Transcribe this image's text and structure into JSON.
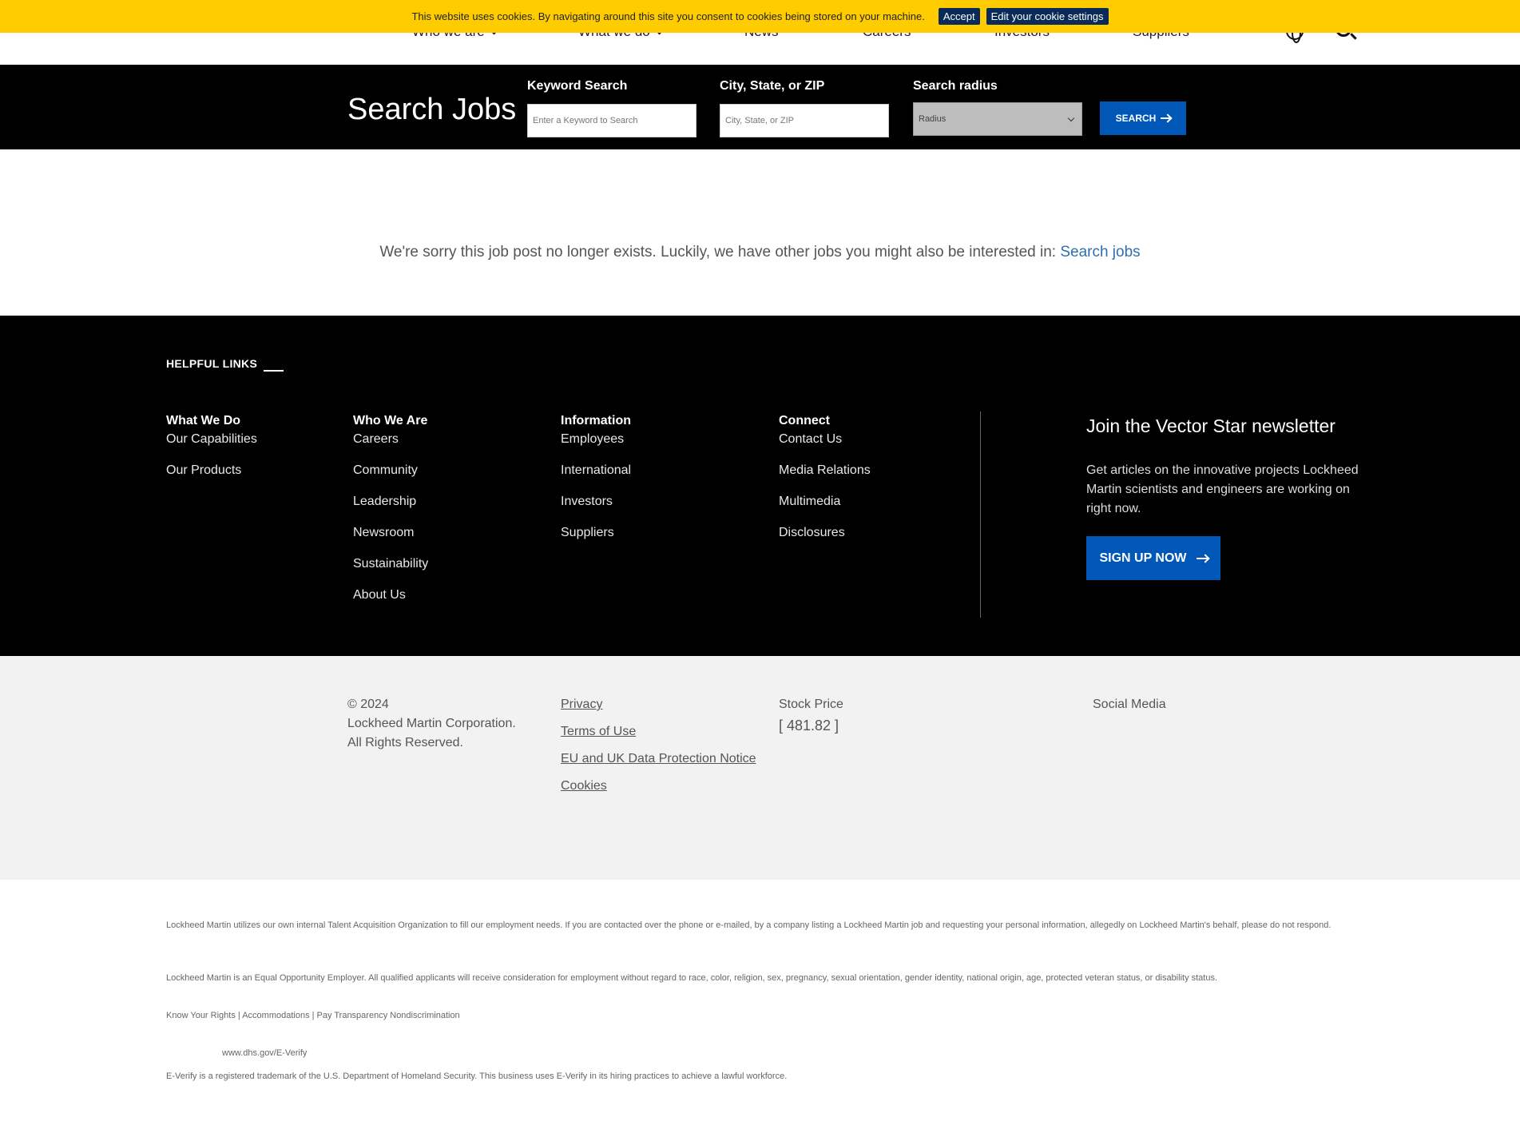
{
  "cookie": {
    "message": "This website uses cookies. By navigating around this site you consent to cookies being stored on your machine.",
    "accept_label": "Accept",
    "settings_label": "Edit your cookie settings"
  },
  "nav": {
    "items": [
      "Who we are",
      "What we do",
      "News",
      "Careers",
      "Investors",
      "Suppliers"
    ]
  },
  "search": {
    "title": "Search Jobs",
    "keyword_label": "Keyword Search",
    "keyword_placeholder": "Enter a Keyword to Search",
    "location_label": "City, State, or ZIP",
    "location_placeholder": "City, State, or ZIP",
    "radius_label": "Search radius",
    "radius_value": "Radius",
    "button_label": "SEARCH"
  },
  "message": {
    "text": "We're sorry this job post no longer exists. Luckily, we have other jobs you might also be interested in:",
    "link": "Search jobs"
  },
  "footer": {
    "helpful_links": "HELPFUL LINKS",
    "columns": [
      {
        "heading": "What We Do",
        "links": [
          "Our Capabilities",
          "Our Products"
        ]
      },
      {
        "heading": "Who We Are",
        "links": [
          "Careers",
          "Community",
          "Leadership",
          "Newsroom",
          "Sustainability",
          "About Us"
        ]
      },
      {
        "heading": "Information",
        "links": [
          "Employees",
          "International",
          "Investors",
          "Suppliers"
        ]
      },
      {
        "heading": "Connect",
        "links": [
          "Contact Us",
          "Media Relations",
          "Multimedia",
          "Disclosures"
        ]
      }
    ],
    "newsletter": {
      "title": "Join the Vector Star newsletter",
      "text": "Get articles on the innovative projects Lockheed Martin scientists and engineers are working on right now.",
      "button": "SIGN UP NOW"
    }
  },
  "bottom": {
    "copyright_year": "© 2024",
    "company": "Lockheed Martin Corporation.",
    "rights": "All Rights Reserved.",
    "links": [
      "Privacy",
      "Terms of Use",
      "EU and UK Data Protection Notice",
      "Cookies"
    ],
    "stock_label": "Stock Price",
    "stock_value": "[ 481.82 ]",
    "social_label": "Social Media"
  },
  "legal": {
    "p1": "Lockheed Martin utilizes our own internal Talent Acquisition Organization to fill our employment needs. If you are contacted over the phone or e-mailed, by a company listing a Lockheed Martin job and requesting your personal information, allegedly on Lockheed Martin's behalf, please do not respond.",
    "p2": "Lockheed Martin is an Equal Opportunity Employer. All qualified applicants will receive consideration for employment without regard to race, color, religion, sex, pregnancy, sexual orientation, gender identity, national origin, age, protected veteran status, or disability status.",
    "p3": "Know Your Rights | Accommodations | Pay Transparency Nondiscrimination",
    "everify_link": "www.dhs.gov/E-Verify",
    "p4": "E-Verify is a registered trademark of the U.S. Department of Homeland Security. This business uses E-Verify in its hiring practices to achieve a lawful workforce."
  }
}
